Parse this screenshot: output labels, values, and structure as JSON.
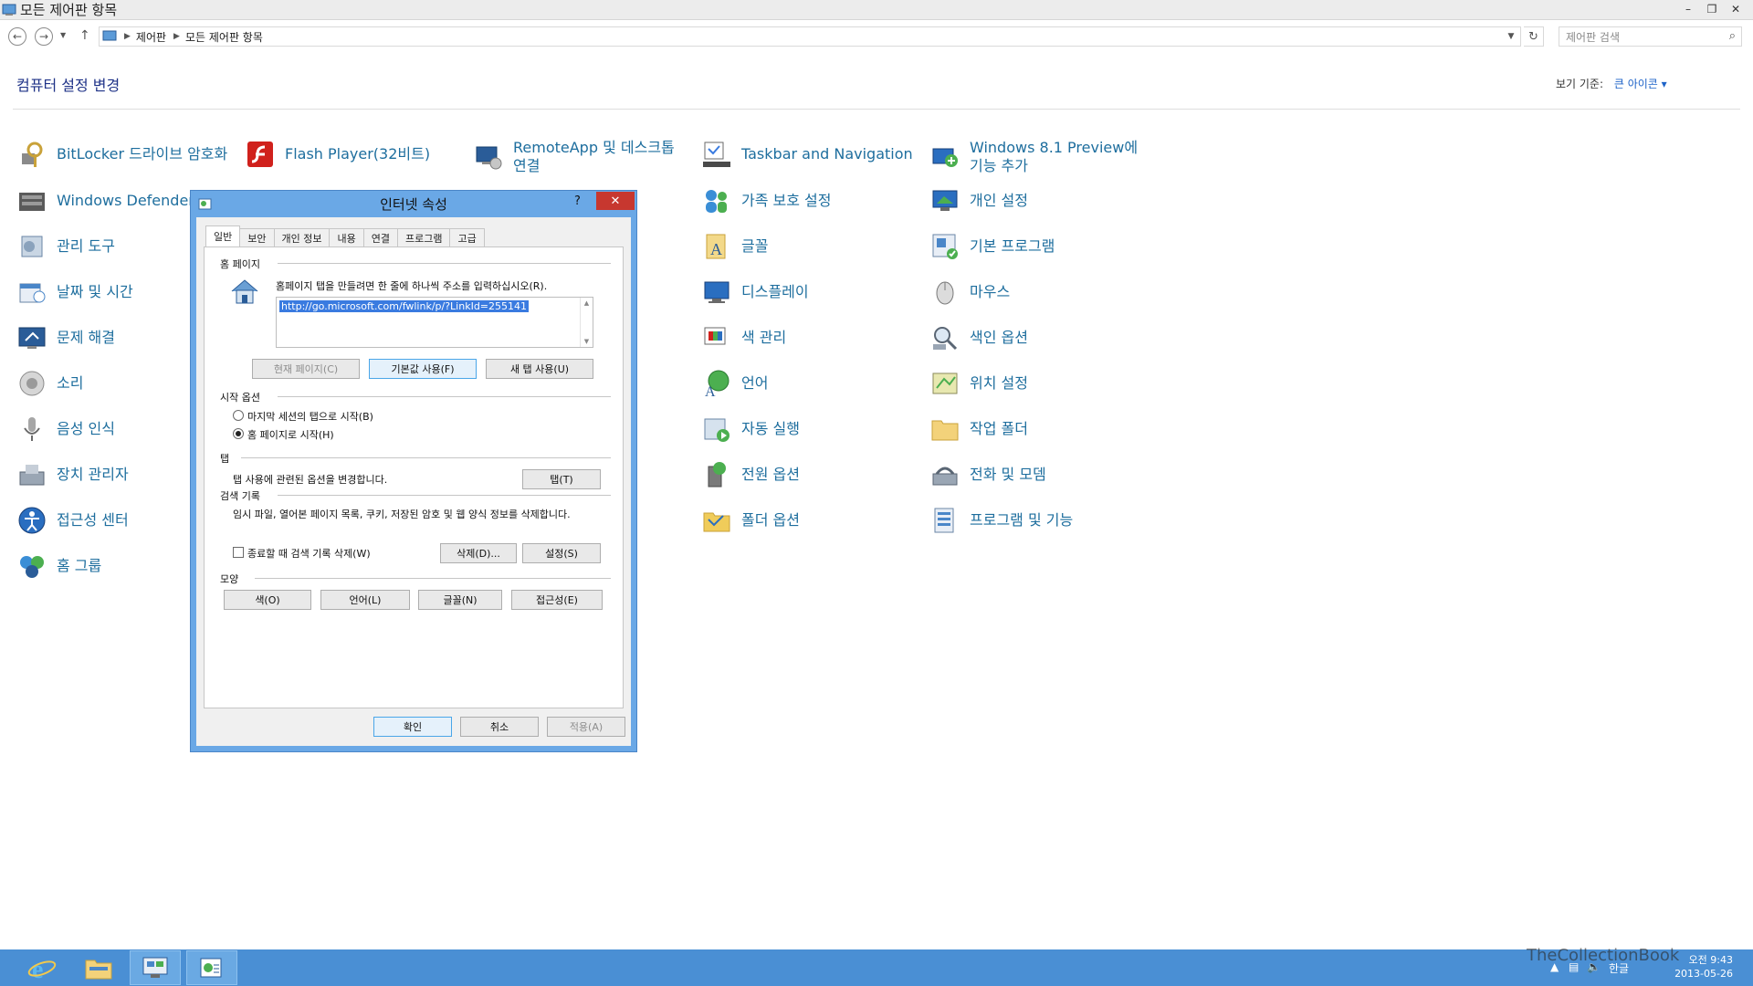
{
  "window": {
    "title": "모든 제어판 항목"
  },
  "address": {
    "crumbs": [
      "제어판",
      "모든 제어판 항목"
    ],
    "search_placeholder": "제어판 검색"
  },
  "header": {
    "title": "컴퓨터 설정 변경",
    "view_by_label": "보기 기준:",
    "view_by_value": "큰 아이콘"
  },
  "items": [
    {
      "label": "BitLocker 드라이브 암호화",
      "icon": "bitlocker-icon"
    },
    {
      "label": "Windows Defender",
      "icon": "defender-icon"
    },
    {
      "label": "관리 도구",
      "icon": "admin-tools-icon"
    },
    {
      "label": "날짜 및 시간",
      "icon": "date-time-icon"
    },
    {
      "label": "문제 해결",
      "icon": "troubleshoot-icon"
    },
    {
      "label": "소리",
      "icon": "sound-icon"
    },
    {
      "label": "음성 인식",
      "icon": "microphone-icon"
    },
    {
      "label": "장치 관리자",
      "icon": "device-manager-icon"
    },
    {
      "label": "접근성 센터",
      "icon": "ease-of-access-icon"
    },
    {
      "label": "홈 그룹",
      "icon": "homegroup-icon"
    },
    {
      "label": "Flash Player(32비트)",
      "icon": "flash-icon"
    },
    {
      "label": "RemoteApp 및 데스크톱 연결",
      "icon": "remoteapp-icon"
    },
    {
      "label": "Taskbar and Navigation",
      "icon": "taskbar-icon"
    },
    {
      "label": "가족 보호 설정",
      "icon": "family-safety-icon"
    },
    {
      "label": "글꼴",
      "icon": "fonts-icon"
    },
    {
      "label": "디스플레이",
      "icon": "display-icon"
    },
    {
      "label": "색 관리",
      "icon": "color-management-icon"
    },
    {
      "label": "언어",
      "icon": "language-icon"
    },
    {
      "label": "자동 실행",
      "icon": "autoplay-icon"
    },
    {
      "label": "전원 옵션",
      "icon": "power-icon"
    },
    {
      "label": "폴더 옵션",
      "icon": "folder-options-icon"
    },
    {
      "label": "Windows 8.1 Preview에 기능 추가",
      "icon": "add-features-icon"
    },
    {
      "label": "개인 설정",
      "icon": "personalization-icon"
    },
    {
      "label": "기본 프로그램",
      "icon": "default-programs-icon"
    },
    {
      "label": "마우스",
      "icon": "mouse-icon"
    },
    {
      "label": "색인 옵션",
      "icon": "indexing-icon"
    },
    {
      "label": "위치 설정",
      "icon": "location-icon"
    },
    {
      "label": "작업 폴더",
      "icon": "work-folders-icon"
    },
    {
      "label": "전화 및 모뎀",
      "icon": "phone-modem-icon"
    },
    {
      "label": "프로그램 및 기능",
      "icon": "programs-features-icon"
    }
  ],
  "dialog": {
    "title": "인터넷 속성",
    "help": "?",
    "tabs": [
      "일반",
      "보안",
      "개인 정보",
      "내용",
      "연결",
      "프로그램",
      "고급"
    ],
    "homepage": {
      "section": "홈 페이지",
      "desc": "홈페이지 탭을 만들려면 한 줄에 하나씩 주소를 입력하십시오(R).",
      "url": "http://go.microsoft.com/fwlink/p/?LinkId=255141",
      "btn_current": "현재 페이지(C)",
      "btn_default": "기본값 사용(F)",
      "btn_newtab": "새 탭 사용(U)"
    },
    "startup": {
      "section": "시작 옵션",
      "opt_last": "마지막 세션의 탭으로 시작(B)",
      "opt_home": "홈 페이지로 시작(H)"
    },
    "tabsec": {
      "section": "탭",
      "desc": "탭 사용에 관련된 옵션을 변경합니다.",
      "btn": "탭(T)"
    },
    "history": {
      "section": "검색 기록",
      "desc": "임시 파일, 열어본 페이지 목록, 쿠키, 저장된 암호 및 웹 양식 정보를 삭제합니다.",
      "checkbox": "종료할 때 검색 기록 삭제(W)",
      "btn_delete": "삭제(D)...",
      "btn_settings": "설정(S)"
    },
    "appearance": {
      "section": "모양",
      "btn_colors": "색(O)",
      "btn_languages": "언어(L)",
      "btn_fonts": "글꼴(N)",
      "btn_access": "접근성(E)"
    },
    "ok": "확인",
    "cancel": "취소",
    "apply": "적용(A)"
  },
  "taskbar": {
    "ime": "한글",
    "time": "오전 9:43",
    "date": "2013-05-26",
    "watermark": "TheCollectionBook"
  }
}
